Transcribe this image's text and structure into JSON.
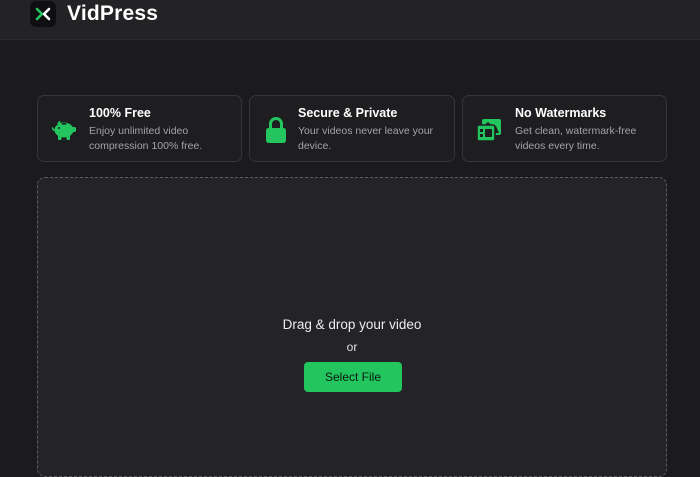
{
  "app": {
    "brand_name": "VidPress",
    "logo_icon": "close-x-logo-icon",
    "accent_color": "#22c55e"
  },
  "features": [
    {
      "icon": "piggy-bank-icon",
      "title": "100% Free",
      "description": "Enjoy unlimited video compression 100% free."
    },
    {
      "icon": "lock-icon",
      "title": "Secure & Private",
      "description": "Your videos never leave your device."
    },
    {
      "icon": "images-icon",
      "title": "No Watermarks",
      "description": "Get clean, watermark-free videos every time."
    }
  ],
  "dropzone": {
    "prompt": "Drag & drop your video",
    "or_text": "or",
    "button_label": "Select File"
  }
}
